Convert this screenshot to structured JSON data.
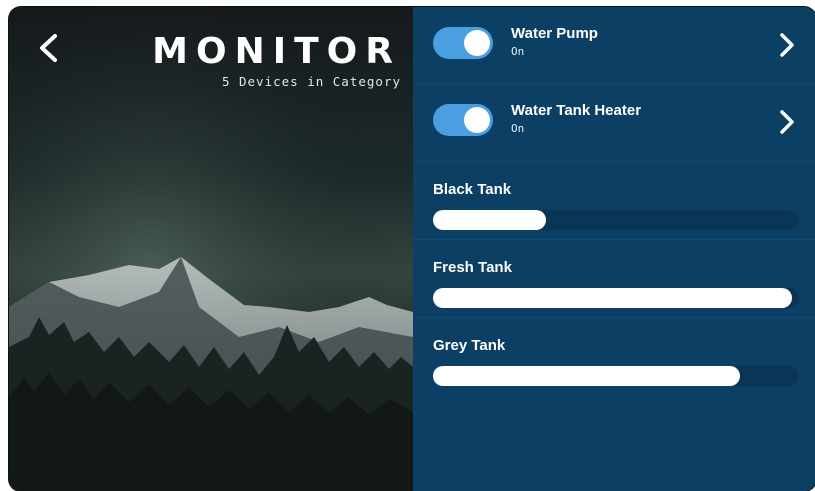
{
  "header": {
    "back_icon": "chevron-left-icon",
    "title": "MONITOR",
    "subtitle": "5 Devices in Category"
  },
  "devices": [
    {
      "name": "Water Pump",
      "status": "On",
      "enabled": true,
      "icon": "chevron-right-icon"
    },
    {
      "name": "Water Tank Heater",
      "status": "On",
      "enabled": true,
      "icon": "chevron-right-icon"
    }
  ],
  "tanks": [
    {
      "name": "Black Tank",
      "level": 0.31
    },
    {
      "name": "Fresh Tank",
      "level": 0.98
    },
    {
      "name": "Grey Tank",
      "level": 0.84
    }
  ],
  "colors": {
    "panel": "#0b3f63",
    "toggle_on": "#4a9fe0",
    "track": "#0a3555",
    "fill": "#ffffff"
  }
}
